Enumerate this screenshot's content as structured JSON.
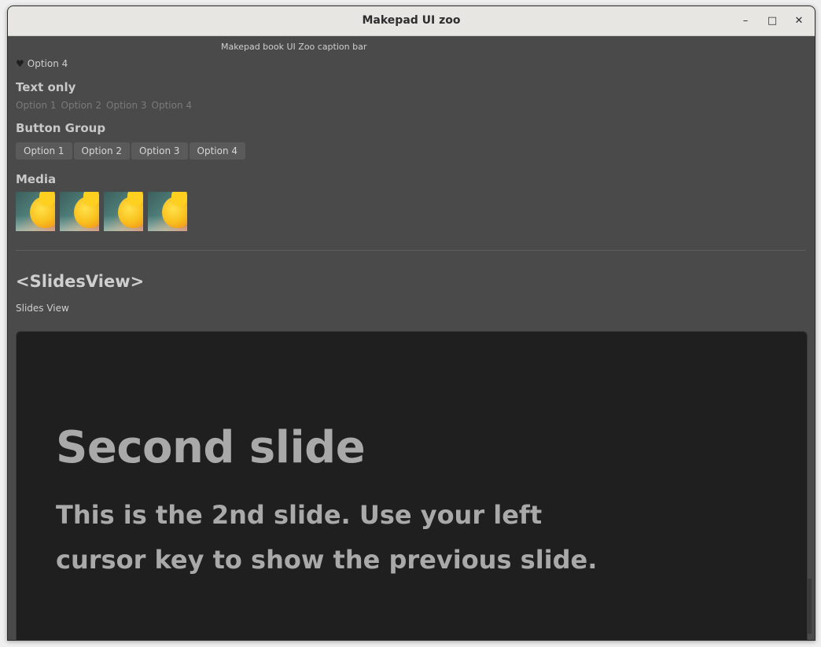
{
  "window": {
    "title": "Makepad UI zoo",
    "controls": {
      "minimize": "–",
      "maximize": "□",
      "close": "✕"
    }
  },
  "caption_bar": {
    "text": "Makepad book UI Zoo caption bar"
  },
  "radio_icon": {
    "icon": "heart-icon",
    "glyph": "♥",
    "label": "Option 4"
  },
  "text_only": {
    "title": "Text only",
    "options": [
      "Option 1",
      "Option 2",
      "Option 3",
      "Option 4"
    ]
  },
  "button_group": {
    "title": "Button Group",
    "options": [
      "Option 1",
      "Option 2",
      "Option 3",
      "Option 4"
    ]
  },
  "media": {
    "title": "Media",
    "count": 4
  },
  "slides_view": {
    "title": "<SlidesView>",
    "subtitle": "Slides View",
    "slide": {
      "heading": "Second slide",
      "body": "This is the 2nd slide. Use your left cursor key to show the previous slide."
    }
  },
  "colors": {
    "background": "#4a4a4a",
    "slide_bg": "#1f1f1f",
    "titlebar_bg": "#e8e6e3"
  }
}
